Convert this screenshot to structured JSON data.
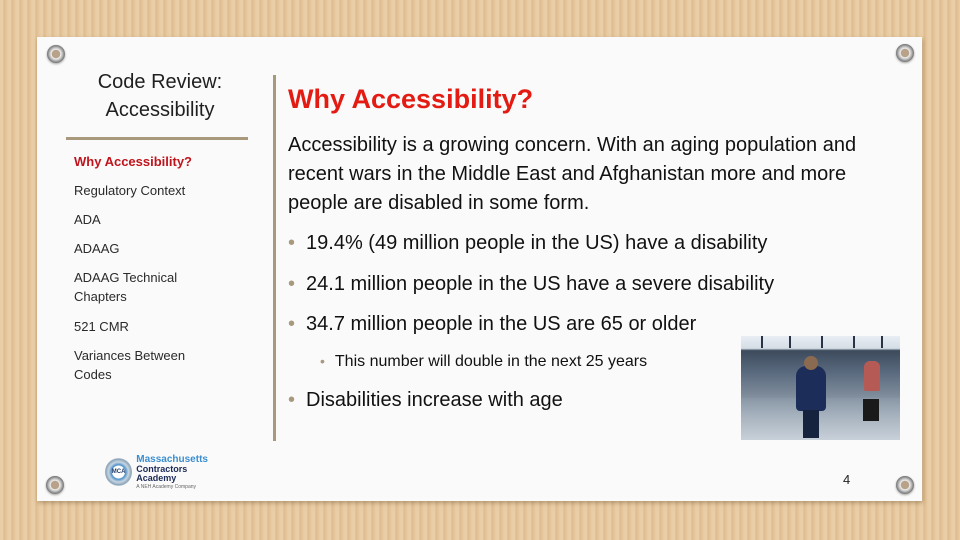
{
  "sidebar": {
    "title": "Code Review: Accessibility",
    "items": [
      {
        "label": "Why Accessibility?",
        "active": true
      },
      {
        "label": "Regulatory Context",
        "active": false
      },
      {
        "label": "ADA",
        "active": false
      },
      {
        "label": "ADAAG",
        "active": false
      },
      {
        "label": "ADAAG Technical Chapters",
        "active": false
      },
      {
        "label": "521 CMR",
        "active": false
      },
      {
        "label": "Variances Between Codes",
        "active": false
      }
    ]
  },
  "main": {
    "title": "Why Accessibility?",
    "intro": "Accessibility is a growing concern. With an aging population and recent wars in the Middle East and Afghanistan more and more people are disabled in some form.",
    "bullets": [
      {
        "text": "19.4% (49 million people in the US) have a disability",
        "level": 1
      },
      {
        "text": "24.1 million people in the US have a severe disability",
        "level": 1
      },
      {
        "text": "34.7 million people in the US are 65 or older",
        "level": 1
      },
      {
        "text": "This number will double in the next 25 years",
        "level": 2
      },
      {
        "text": "Disabilities increase with age",
        "level": 1
      }
    ],
    "bullet_glyph": "•",
    "photo_label": "airport-photo-person-with-cane"
  },
  "logo": {
    "badge": "MCA",
    "line1": "Massachusetts",
    "line2": "Contractors Academy",
    "line3": "A NEH Academy Company"
  },
  "footer": {
    "page_number": "4"
  },
  "colors": {
    "title_red": "#e31b12",
    "active_nav_red": "#c0141c",
    "rule_tan": "#a8987c",
    "background_cardboard": "#e7c9a0"
  }
}
